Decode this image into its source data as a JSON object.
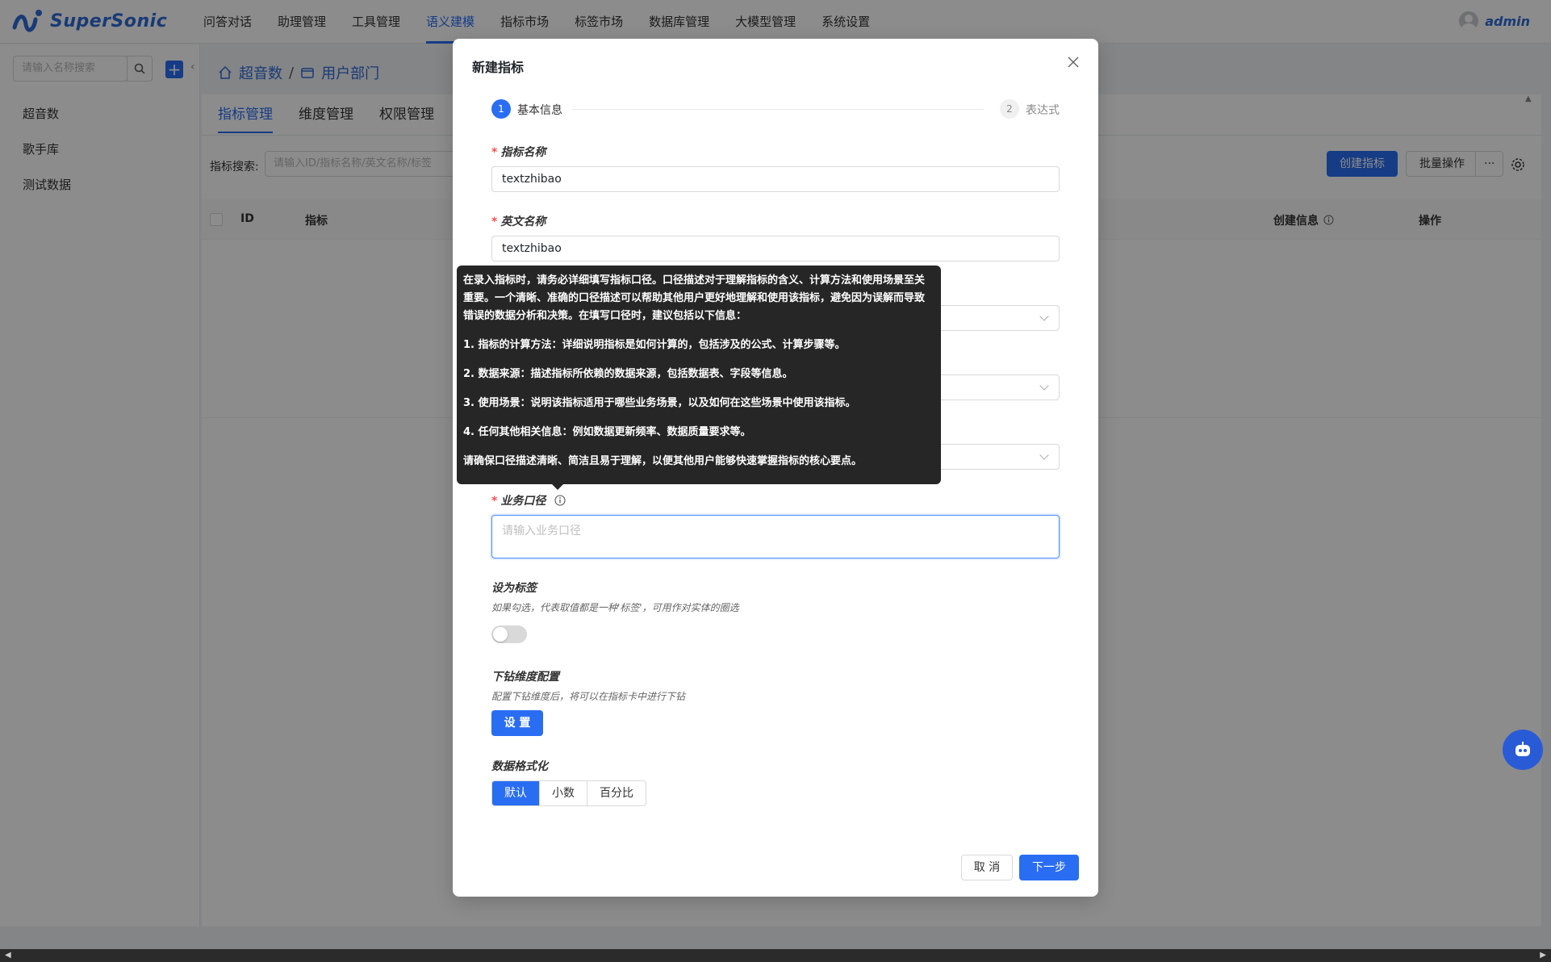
{
  "app": {
    "brand": "SuperSonic",
    "user": "admin"
  },
  "nav": {
    "items": [
      "问答对话",
      "助理管理",
      "工具管理",
      "语义建模",
      "指标市场",
      "标签市场",
      "数据库管理",
      "大模型管理",
      "系统设置"
    ],
    "active_index": 3
  },
  "sidebar": {
    "search_placeholder": "请输入名称搜索",
    "items": [
      "超音数",
      "歌手库",
      "测试数据"
    ]
  },
  "breadcrumb": {
    "root": "超音数",
    "separator": "/",
    "current": "用户部门"
  },
  "tabs": [
    "指标管理",
    "维度管理",
    "权限管理"
  ],
  "toolbar": {
    "search_label": "指标搜索:",
    "search_placeholder": "请输入ID/指标名称/英文名称/标签",
    "create_label": "创建指标",
    "batch_label": "批量操作",
    "more_label": "···"
  },
  "table": {
    "columns": [
      "ID",
      "指标",
      "创建信息",
      "操作"
    ]
  },
  "modal": {
    "title": "新建指标",
    "steps": [
      {
        "num": "1",
        "label": "基本信息"
      },
      {
        "num": "2",
        "label": "表达式"
      }
    ],
    "fields": {
      "name_label": "指标名称",
      "name_value": "textzhibao",
      "en_label": "英文名称",
      "en_value": "textzhibao",
      "caliber_label": "业务口径",
      "caliber_placeholder": "请输入业务口径",
      "tag_label": "设为标签",
      "tag_help": "如果勾选，代表取值都是一种'标签'，可用作对实体的圈选",
      "tag_on": false,
      "drill_label": "下钻维度配置",
      "drill_help": "配置下钻维度后，将可以在指标卡中进行下钻",
      "drill_button": "设 置",
      "format_label": "数据格式化",
      "format_options": [
        "默认",
        "小数",
        "百分比"
      ],
      "format_selected": "默认"
    },
    "cancel_label": "取 消",
    "next_label": "下一步"
  },
  "tooltip": {
    "intro": "在录入指标时，请务必详细填写指标口径。口径描述对于理解指标的含义、计算方法和使用场景至关重要。一个清晰、准确的口径描述可以帮助其他用户更好地理解和使用该指标，避免因为误解而导致错误的数据分析和决策。在填写口径时，建议包括以下信息：",
    "point1": "1. 指标的计算方法：详细说明指标是如何计算的，包括涉及的公式、计算步骤等。",
    "point2": "2. 数据来源：描述指标所依赖的数据来源，包括数据表、字段等信息。",
    "point3": "3. 使用场景：说明该指标适用于哪些业务场景，以及如何在这些场景中使用该指标。",
    "point4": "4. 任何其他相关信息：例如数据更新频率、数据质量要求等。",
    "outro": "请确保口径描述清晰、简洁且易于理解，以便其他用户能够快速掌握指标的核心要点。"
  },
  "colors": {
    "primary": "#296df3",
    "brand": "#2f6bd8",
    "required": "#ff4d4f",
    "tooltip_bg": "#262626"
  },
  "icons": [
    "home-icon",
    "folder-icon",
    "search-icon",
    "plus-icon",
    "close-icon",
    "info-icon",
    "settings-icon",
    "robot-icon"
  ]
}
